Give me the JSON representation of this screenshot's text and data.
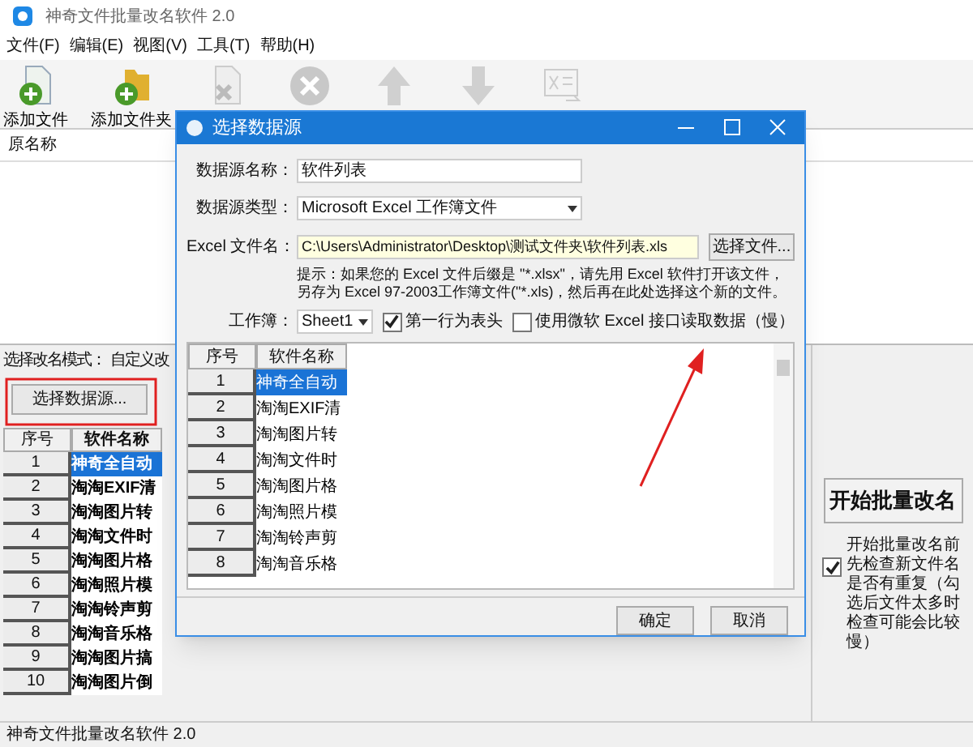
{
  "window": {
    "title": "神奇文件批量改名软件 2.0"
  },
  "menu": [
    "文件(F)",
    "编辑(E)",
    "视图(V)",
    "工具(T)",
    "帮助(H)"
  ],
  "toolbar": [
    {
      "kind": "add-file",
      "label": "添加文件",
      "disabled": false
    },
    {
      "kind": "add-folder",
      "label": "添加文件夹",
      "disabled": false
    },
    {
      "kind": "remove",
      "disabled": true
    },
    {
      "kind": "clear",
      "disabled": true
    },
    {
      "kind": "up",
      "disabled": true
    },
    {
      "kind": "down",
      "disabled": true
    },
    {
      "kind": "export",
      "disabled": true
    }
  ],
  "file_list": {
    "columns": [
      "原名称"
    ]
  },
  "mode": {
    "label": "选择改名模式：",
    "value": "自定义改"
  },
  "data_source_button": "选择数据源...",
  "table": {
    "columns": [
      "序号",
      "软件名称"
    ],
    "rows": [
      {
        "cells": [
          "1",
          "神奇全自动"
        ],
        "selected": true
      },
      {
        "cells": [
          "2",
          "淘淘EXIF清"
        ],
        "selected": false
      },
      {
        "cells": [
          "3",
          "淘淘图片转"
        ],
        "selected": false
      },
      {
        "cells": [
          "4",
          "淘淘文件时"
        ],
        "selected": false
      },
      {
        "cells": [
          "5",
          "淘淘图片格"
        ],
        "selected": false
      },
      {
        "cells": [
          "6",
          "淘淘照片模"
        ],
        "selected": false
      },
      {
        "cells": [
          "7",
          "淘淘铃声剪"
        ],
        "selected": false
      },
      {
        "cells": [
          "8",
          "淘淘音乐格"
        ],
        "selected": false
      },
      {
        "cells": [
          "9",
          "淘淘图片搞"
        ],
        "selected": false
      },
      {
        "cells": [
          "10",
          "淘淘图片倒"
        ],
        "selected": false
      }
    ]
  },
  "start_button": "开始批量改名",
  "check_duplicates": {
    "label": "开始批量改名前先检查新文件名是否有重复（勾选后文件太多时检查可能会比较慢）",
    "checked": true
  },
  "status_bar": "神奇文件批量改名软件 2.0",
  "dialog": {
    "title": "选择数据源",
    "fields": [
      {
        "kind": "text",
        "label": "数据源名称：",
        "value": "软件列表"
      },
      {
        "kind": "select",
        "label": "数据源类型：",
        "value": "Microsoft Excel 工作簿文件"
      },
      {
        "kind": "file",
        "label": "Excel 文件名：",
        "value": "C:\\Users\\Administrator\\Desktop\\测试文件夹\\软件列表.xls",
        "button": "选择文件..."
      }
    ],
    "hint": "提示：如果您的 Excel 文件后缀是 \"*.xlsx\"，请先用 Excel 软件打开该文件，另存为 Excel 97-2003工作簿文件(\"*.xls)，然后再在此处选择这个新的文件。",
    "sheet": {
      "label": "工作簿：",
      "value": "Sheet1"
    },
    "options": [
      {
        "label": "第一行为表头",
        "checked": true
      },
      {
        "label": "使用微软 Excel 接口读取数据（慢）",
        "checked": false
      }
    ],
    "grid": {
      "columns": [
        "序号",
        "软件名称"
      ],
      "rows": [
        {
          "cells": [
            "1",
            "神奇全自动"
          ],
          "selected": true
        },
        {
          "cells": [
            "2",
            "淘淘EXIF清"
          ],
          "selected": false
        },
        {
          "cells": [
            "3",
            "淘淘图片转"
          ],
          "selected": false
        },
        {
          "cells": [
            "4",
            "淘淘文件时"
          ],
          "selected": false
        },
        {
          "cells": [
            "5",
            "淘淘图片格"
          ],
          "selected": false
        },
        {
          "cells": [
            "6",
            "淘淘照片模"
          ],
          "selected": false
        },
        {
          "cells": [
            "7",
            "淘淘铃声剪"
          ],
          "selected": false
        },
        {
          "cells": [
            "8",
            "淘淘音乐格"
          ],
          "selected": false
        }
      ]
    },
    "buttons": [
      "确定",
      "取消"
    ]
  }
}
